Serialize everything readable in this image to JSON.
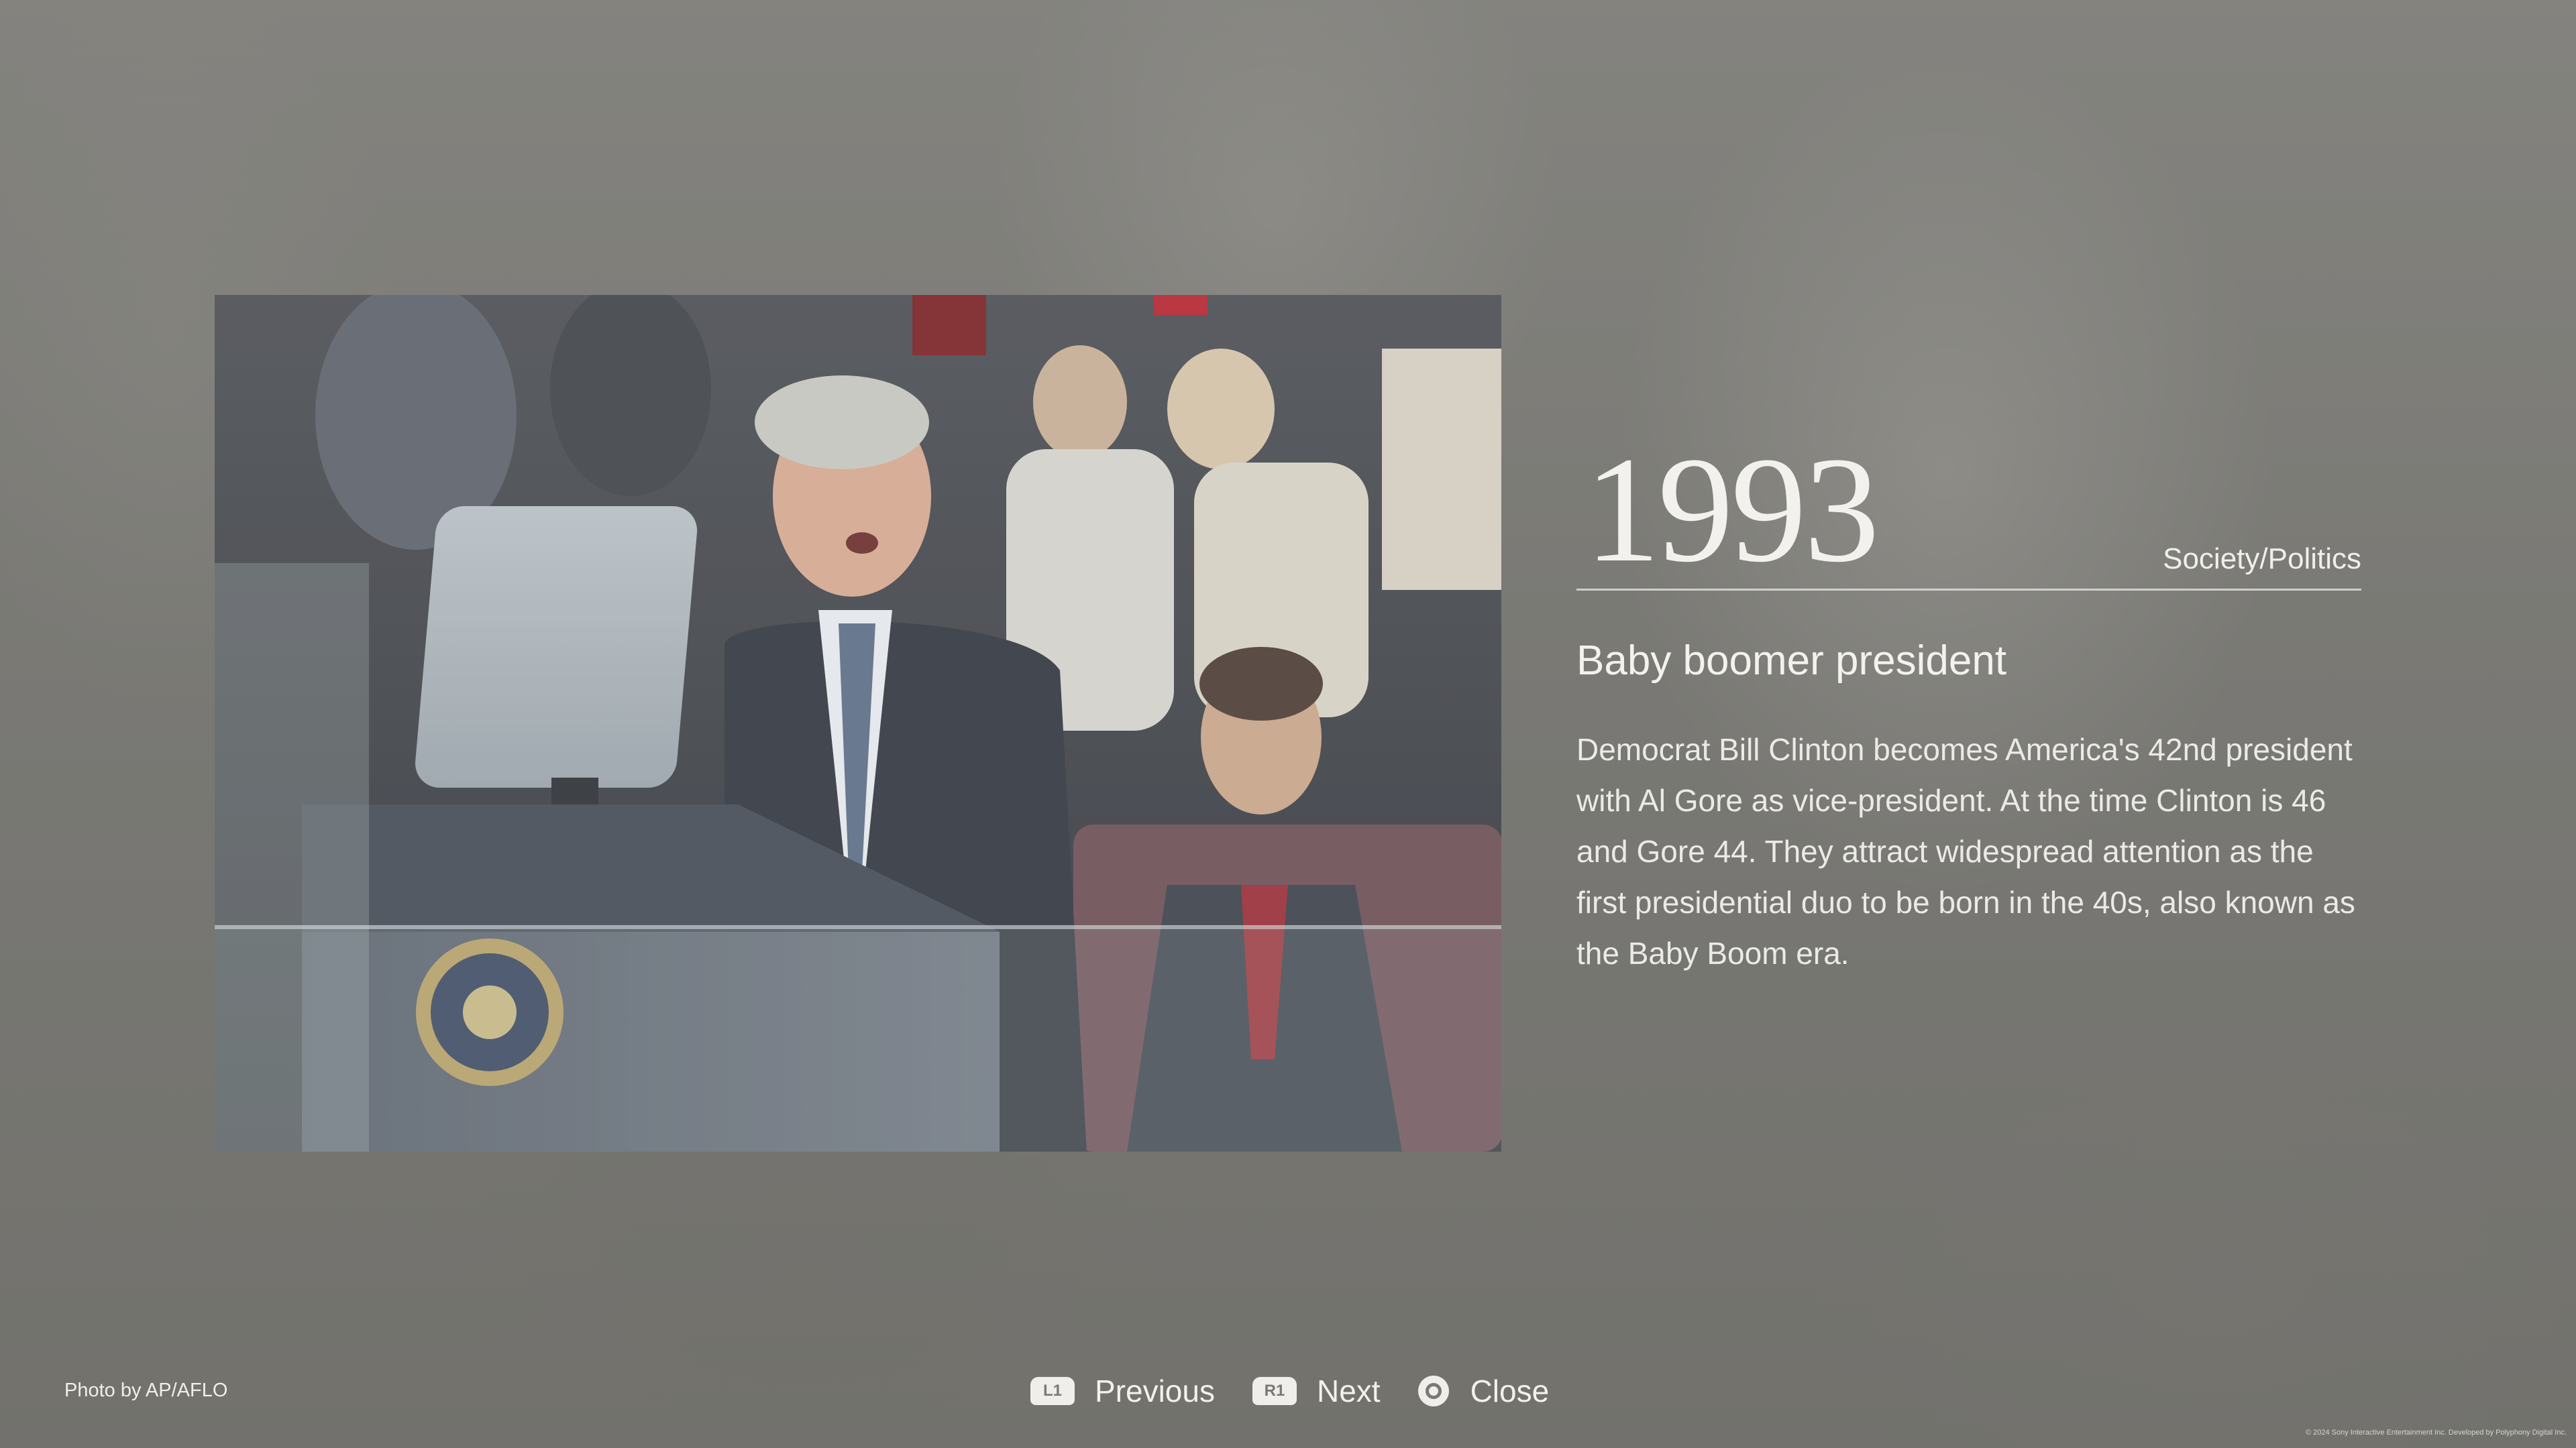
{
  "event": {
    "year": "1993",
    "category": "Society/Politics",
    "headline": "Baby boomer president",
    "description": "Democrat Bill Clinton becomes America's 42nd president with Al Gore as vice-president. At the time Clinton is 46 and Gore 44. They attract widespread attention as the first presidential duo to be born in the 40s, also known as the Baby Boom era."
  },
  "photo": {
    "credit": "Photo by AP/AFLO"
  },
  "controls": {
    "previous": {
      "button": "L1",
      "label": "Previous"
    },
    "next": {
      "button": "R1",
      "label": "Next"
    },
    "close": {
      "label": "Close",
      "icon": "circle-button-icon"
    }
  },
  "footer": {
    "legal": "© 2024 Sony Interactive Entertainment Inc. Developed by Polyphony Digital Inc."
  }
}
